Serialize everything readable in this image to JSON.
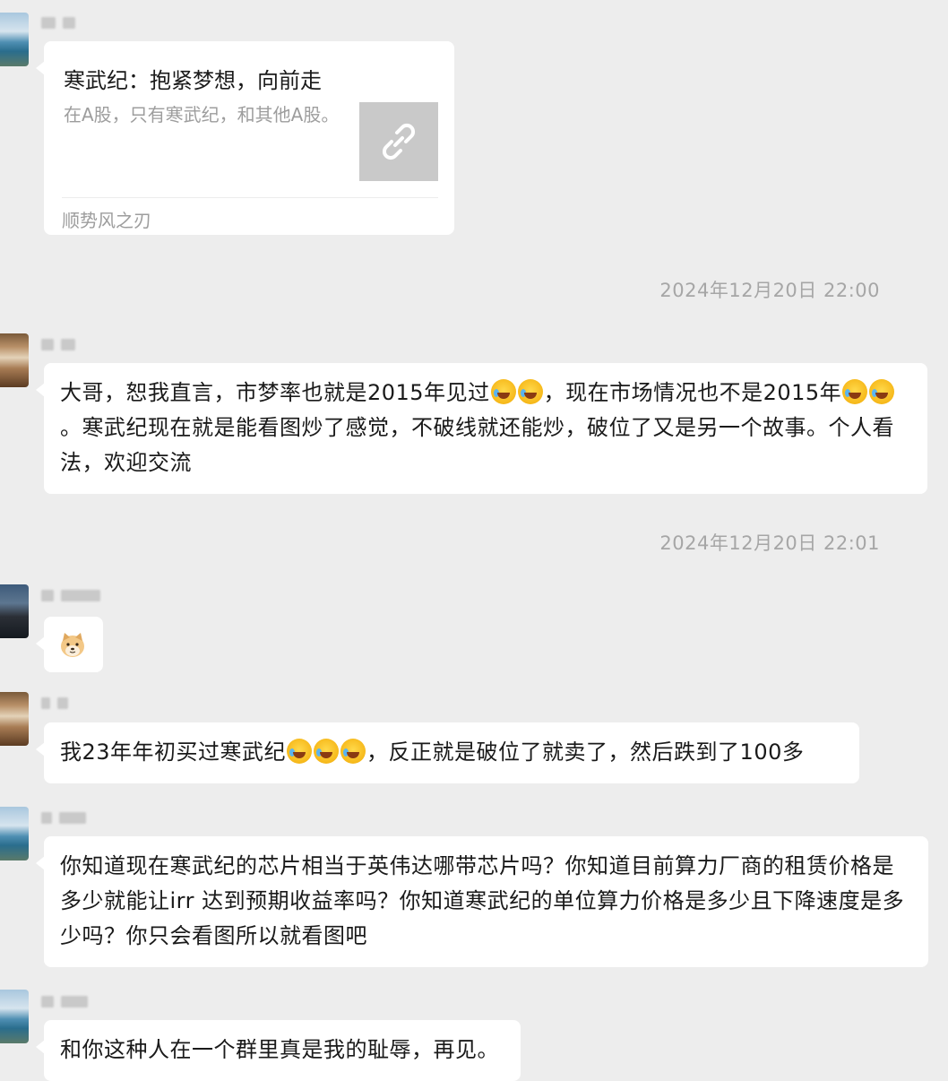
{
  "messages": {
    "link_card": {
      "title": "寒武纪：抱紧梦想，向前走",
      "description": "在A股，只有寒武纪，和其他A股。",
      "source": "顺势风之刃",
      "thumbnail_icon": "link-icon"
    },
    "time_1": "2024年12月20日 22:00",
    "msg_1_part1": "大哥，恕我直言，市梦率也就是2015年见过",
    "msg_1_part2": "，现在市场情况也不是2015年",
    "msg_1_part3": "。寒武纪现在就是能看图炒了感觉，不破线就还能炒，破位了又是另一个故事。个人看法，欢迎交流",
    "time_2": "2024年12月20日 22:01",
    "doge_sticker": "doge-emoji",
    "msg_3_part1": "我23年年初买过寒武纪",
    "msg_3_part2": "，反正就是破位了就卖了，然后跌到了100多",
    "msg_4": "你知道现在寒武纪的芯片相当于英伟达哪带芯片吗？你知道目前算力厂商的租赁价格是多少就能让irr 达到预期收益率吗？你知道寒武纪的单位算力价格是多少且下降速度是多少吗？你只会看图所以就看图吧",
    "msg_5": "和你这种人在一个群里真是我的耻辱，再见。",
    "emoji_name": "laughing-crying-emoji"
  },
  "colors": {
    "background": "#ededed",
    "bubble": "#ffffff",
    "timestamp": "#a6a6a6",
    "secondary_text": "#9d9d9d"
  }
}
